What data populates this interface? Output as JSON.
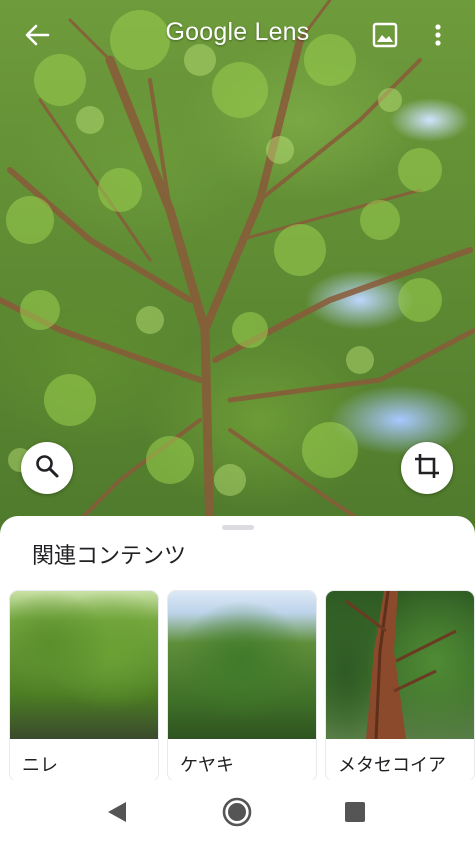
{
  "app": {
    "title": "Google Lens"
  },
  "icons": {
    "back": "arrow-back-icon",
    "gallery": "image-gallery-icon",
    "more": "more-vert-icon",
    "search": "search-icon",
    "crop": "crop-icon"
  },
  "sheet": {
    "title": "関連コンテンツ",
    "results": [
      {
        "label": "ニレ"
      },
      {
        "label": "ケヤキ"
      },
      {
        "label": "メタセコイア"
      }
    ]
  },
  "colors": {
    "sheet_bg": "#ffffff",
    "text_primary": "#202124",
    "nav_icons": "#555555"
  }
}
